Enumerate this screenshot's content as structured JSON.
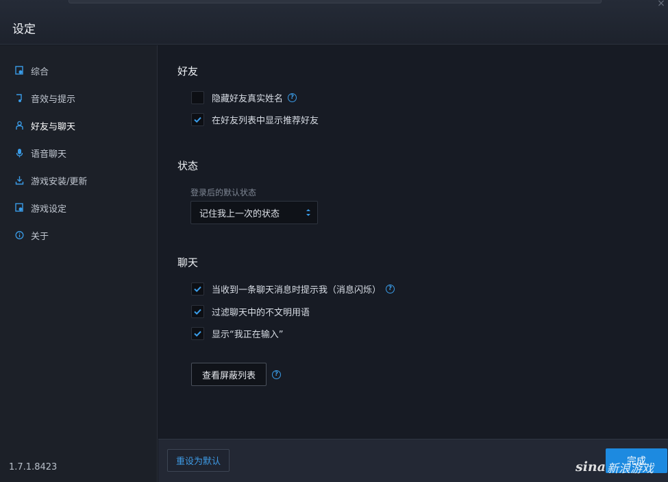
{
  "window": {
    "title": "设定",
    "close_glyph": "×"
  },
  "sidebar": {
    "items": [
      {
        "label": "综合",
        "icon": "settings-page-icon"
      },
      {
        "label": "音效与提示",
        "icon": "music-note-icon"
      },
      {
        "label": "好友与聊天",
        "icon": "person-icon"
      },
      {
        "label": "语音聊天",
        "icon": "microphone-icon"
      },
      {
        "label": "游戏安装/更新",
        "icon": "download-icon"
      },
      {
        "label": "游戏设定",
        "icon": "game-settings-icon"
      },
      {
        "label": "关于",
        "icon": "info-icon"
      }
    ],
    "active_index": 2,
    "version": "1.7.1.8423"
  },
  "friends": {
    "title": "好友",
    "options": [
      {
        "label": "隐藏好友真实姓名",
        "checked": false,
        "help": true
      },
      {
        "label": "在好友列表中显示推荐好友",
        "checked": true,
        "help": false
      }
    ]
  },
  "status": {
    "title": "状态",
    "field_label": "登录后的默认状态",
    "selected": "记住我上一次的状态"
  },
  "chat": {
    "title": "聊天",
    "options": [
      {
        "label": "当收到一条聊天消息时提示我（消息闪烁）",
        "checked": true,
        "help": true
      },
      {
        "label": "过滤聊天中的不文明用语",
        "checked": true,
        "help": false
      },
      {
        "label": "显示“我正在输入”",
        "checked": true,
        "help": false
      }
    ],
    "blocklist_button": "查看屏蔽列表"
  },
  "footer": {
    "reset_label": "重设为默认",
    "done_label": "完成"
  },
  "watermark": {
    "brand": "sina",
    "text": "新浪游戏"
  },
  "colors": {
    "accent": "#1d8ae0",
    "link": "#3e9be6",
    "background": "#171b24"
  }
}
